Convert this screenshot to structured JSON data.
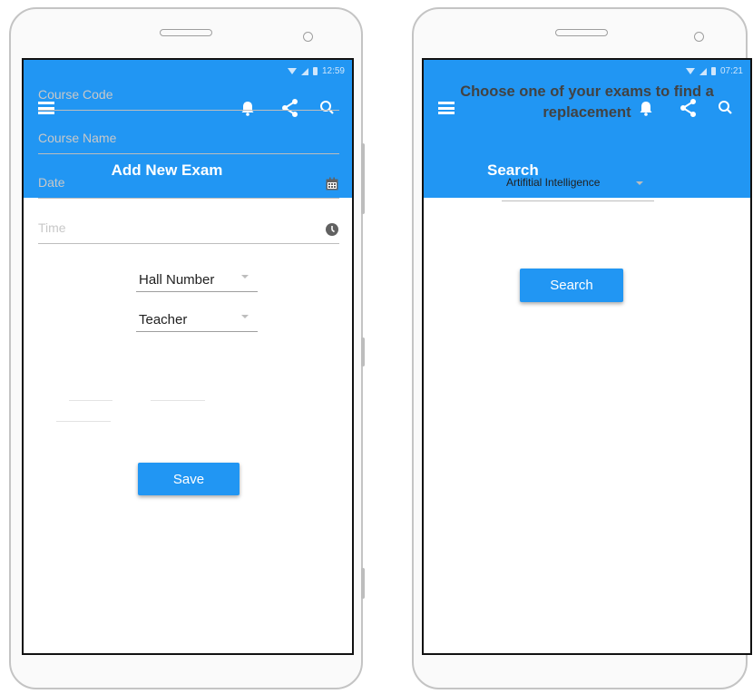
{
  "left_screen": {
    "status_time": "12:59",
    "title": "Add New Exam",
    "fields": {
      "course_code_placeholder": "Course Code",
      "course_name_placeholder": "Course Name",
      "date_placeholder": "Date",
      "time_placeholder": "Time"
    },
    "dropdowns": {
      "hall_number": "Hall Number",
      "teacher": "Teacher"
    },
    "save_label": "Save"
  },
  "right_screen": {
    "status_time": "07:21",
    "title": "Search",
    "prompt": "Choose one of your exams to find a replacement",
    "exam_select_value": "Artifitial Intelligence",
    "search_label": "Search"
  },
  "icons": {
    "menu": "menu-icon",
    "notifications": "bell-icon",
    "share": "share-icon",
    "search": "search-icon",
    "date": "calendar-icon",
    "time": "clock-icon"
  },
  "colors": {
    "primary": "#2196f3",
    "on_primary": "#ffffff",
    "field_line": "#bdbdbd",
    "placeholder": "#c8c8c8",
    "heading_text": "#424242"
  }
}
